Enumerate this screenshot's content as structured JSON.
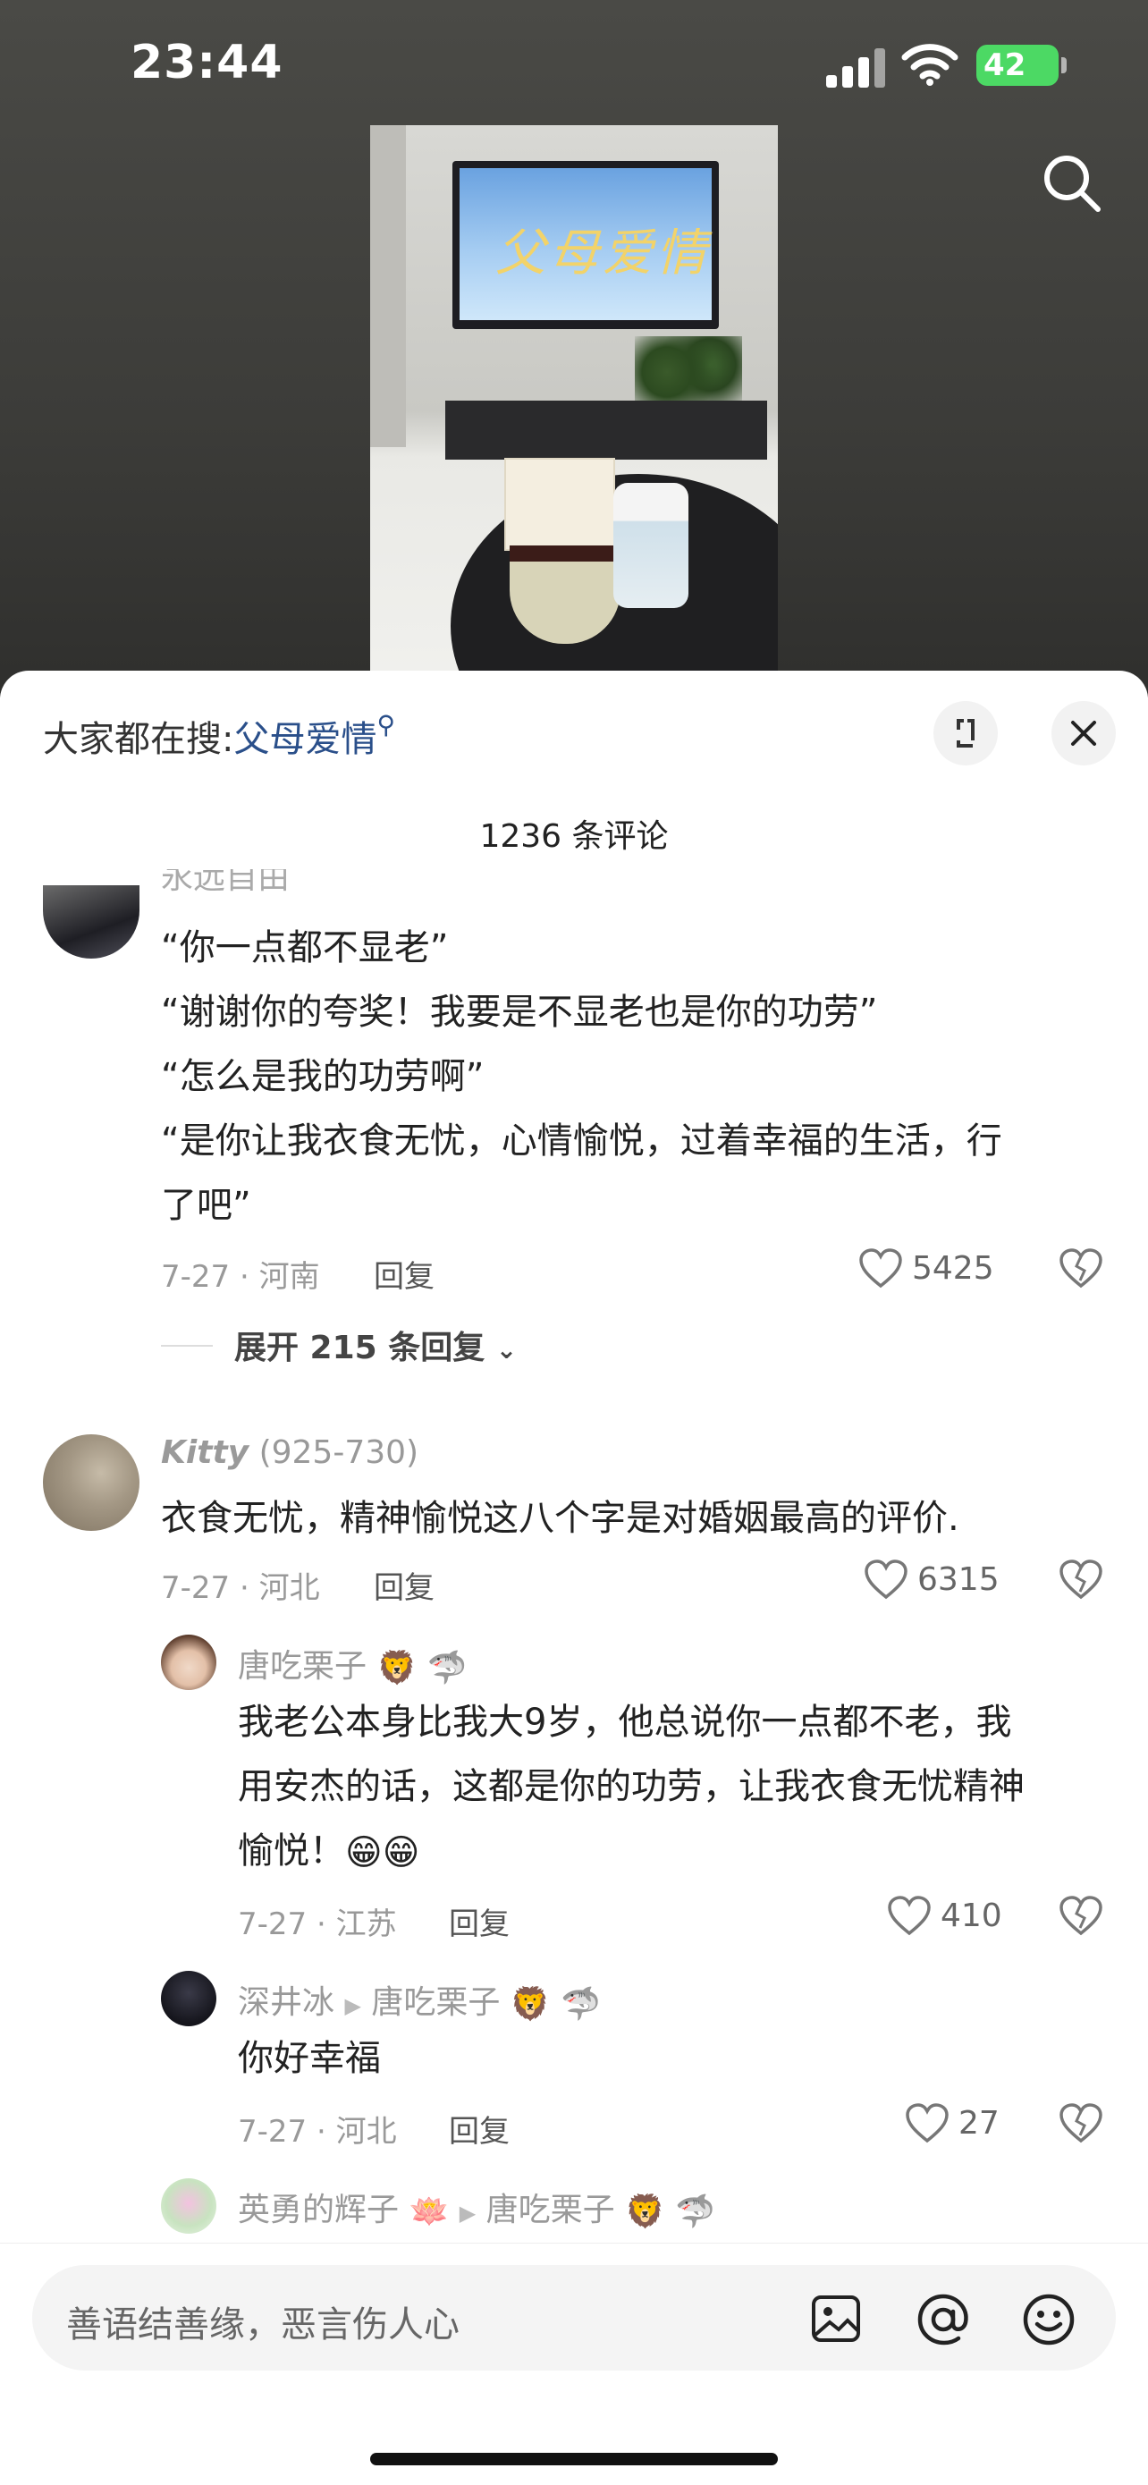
{
  "status": {
    "time": "23:44",
    "battery": "42"
  },
  "video": {
    "tv_title": "父母爱情"
  },
  "sheet": {
    "hot_prefix": "大家都在搜:",
    "hot_keyword": "父母爱情",
    "comment_count": "1236 条评论"
  },
  "comment1": {
    "name": "永远自由",
    "lines": [
      "“你一点都不显老”",
      "“谢谢你的夸奖！我要是不显老也是你的功劳”",
      "“怎么是我的功劳啊”",
      "“是你让我衣食无忧，心情愉悦，过着幸福的生活，行",
      "了吧”"
    ],
    "meta": "7-27 · 河南",
    "reply": "回复",
    "likes": "5425",
    "expand": "展开 215 条回复"
  },
  "comment2": {
    "name": "Kitty",
    "name_suffix": "(925-730)",
    "text": "衣食无忧，精神愉悦这八个字是对婚姻最高的评价.",
    "meta": "7-27 · 河北",
    "reply": "回复",
    "likes": "6315"
  },
  "reply1": {
    "name": "唐吃栗子",
    "lines": [
      "我老公本身比我大9岁，他总说你一点都不老，我",
      "用安杰的话，这都是你的功劳，让我衣食无忧精神",
      "愉悦！"
    ],
    "meta": "7-27 · 江苏",
    "reply": "回复",
    "likes": "410"
  },
  "reply2": {
    "name": "深井冰",
    "to": "唐吃栗子",
    "text": "你好幸福",
    "meta": "7-27 · 河北",
    "reply": "回复",
    "likes": "27"
  },
  "reply3": {
    "name": "英勇的辉子",
    "to": "唐吃栗子"
  },
  "input": {
    "placeholder": "善语结善缘，恶言伤人心"
  }
}
